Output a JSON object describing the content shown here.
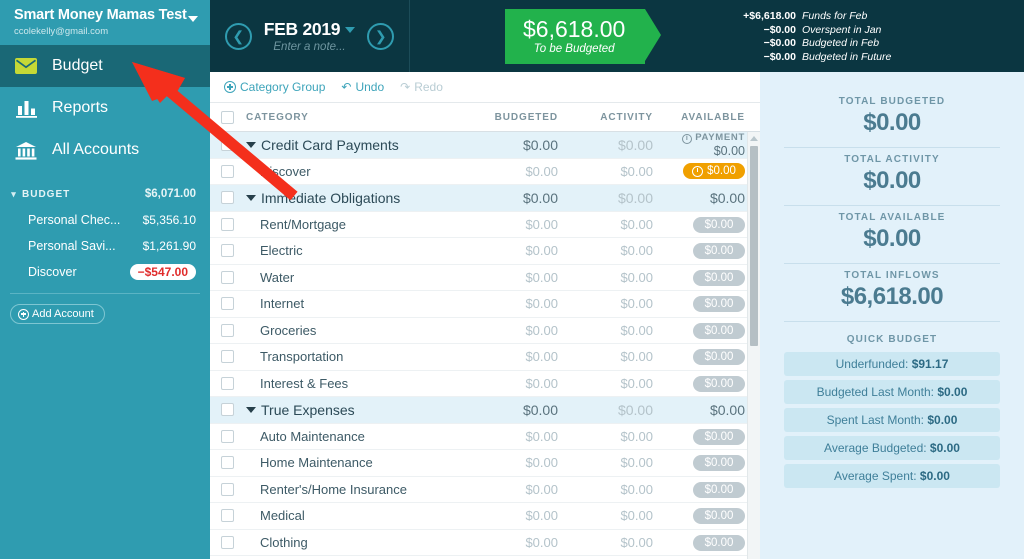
{
  "sidebar": {
    "budget_name": "Smart Money Mamas Test",
    "email": "ccolekelly@gmail.com",
    "nav": [
      {
        "label": "Budget",
        "icon": "envelope-icon",
        "active": true
      },
      {
        "label": "Reports",
        "icon": "bar-chart-icon",
        "active": false
      },
      {
        "label": "All Accounts",
        "icon": "bank-icon",
        "active": false
      }
    ],
    "accounts_header": {
      "label": "BUDGET",
      "amount": "$6,071.00"
    },
    "accounts": [
      {
        "name": "Personal Chec...",
        "balance": "$5,356.10",
        "negative": false
      },
      {
        "name": "Personal Savi...",
        "balance": "$1,261.90",
        "negative": false
      },
      {
        "name": "Discover",
        "balance": "−$547.00",
        "negative": true
      }
    ],
    "add_account_label": "Add Account"
  },
  "header": {
    "prev_icon": "chevron-left-circle-icon",
    "next_icon": "chevron-right-circle-icon",
    "month": "FEB 2019",
    "note_placeholder": "Enter a note...",
    "to_be_budgeted_amount": "$6,618.00",
    "to_be_budgeted_label": "To be Budgeted",
    "breakdown": [
      {
        "amount": "+$6,618.00",
        "label": "Funds for Feb"
      },
      {
        "amount": "−$0.00",
        "label": "Overspent in Jan"
      },
      {
        "amount": "−$0.00",
        "label": "Budgeted in Feb"
      },
      {
        "amount": "−$0.00",
        "label": "Budgeted in Future"
      }
    ]
  },
  "toolbar": {
    "category_group_label": "Category Group",
    "undo_label": "Undo",
    "redo_label": "Redo"
  },
  "table": {
    "columns": {
      "category": "CATEGORY",
      "budgeted": "BUDGETED",
      "activity": "ACTIVITY",
      "available": "AVAILABLE"
    },
    "rows": [
      {
        "type": "group",
        "name": "Credit Card Payments",
        "budgeted": "$0.00",
        "activity": "$0.00",
        "available_kind": "payment",
        "payment_label": "PAYMENT",
        "available": "$0.00"
      },
      {
        "type": "child",
        "name": "Discover",
        "budgeted": "$0.00",
        "activity": "$0.00",
        "available_kind": "pill-orange",
        "available": "$0.00"
      },
      {
        "type": "group",
        "name": "Immediate Obligations",
        "budgeted": "$0.00",
        "activity": "$0.00",
        "available_kind": "plain",
        "available": "$0.00"
      },
      {
        "type": "child",
        "name": "Rent/Mortgage",
        "budgeted": "$0.00",
        "activity": "$0.00",
        "available_kind": "pill",
        "available": "$0.00"
      },
      {
        "type": "child",
        "name": "Electric",
        "budgeted": "$0.00",
        "activity": "$0.00",
        "available_kind": "pill",
        "available": "$0.00"
      },
      {
        "type": "child",
        "name": "Water",
        "budgeted": "$0.00",
        "activity": "$0.00",
        "available_kind": "pill",
        "available": "$0.00"
      },
      {
        "type": "child",
        "name": "Internet",
        "budgeted": "$0.00",
        "activity": "$0.00",
        "available_kind": "pill",
        "available": "$0.00"
      },
      {
        "type": "child",
        "name": "Groceries",
        "budgeted": "$0.00",
        "activity": "$0.00",
        "available_kind": "pill",
        "available": "$0.00"
      },
      {
        "type": "child",
        "name": "Transportation",
        "budgeted": "$0.00",
        "activity": "$0.00",
        "available_kind": "pill",
        "available": "$0.00"
      },
      {
        "type": "child",
        "name": "Interest & Fees",
        "budgeted": "$0.00",
        "activity": "$0.00",
        "available_kind": "pill",
        "available": "$0.00"
      },
      {
        "type": "group",
        "name": "True Expenses",
        "budgeted": "$0.00",
        "activity": "$0.00",
        "available_kind": "plain",
        "available": "$0.00"
      },
      {
        "type": "child",
        "name": "Auto Maintenance",
        "budgeted": "$0.00",
        "activity": "$0.00",
        "available_kind": "pill",
        "available": "$0.00"
      },
      {
        "type": "child",
        "name": "Home Maintenance",
        "budgeted": "$0.00",
        "activity": "$0.00",
        "available_kind": "pill",
        "available": "$0.00"
      },
      {
        "type": "child",
        "name": "Renter's/Home Insurance",
        "budgeted": "$0.00",
        "activity": "$0.00",
        "available_kind": "pill",
        "available": "$0.00"
      },
      {
        "type": "child",
        "name": "Medical",
        "budgeted": "$0.00",
        "activity": "$0.00",
        "available_kind": "pill",
        "available": "$0.00"
      },
      {
        "type": "child",
        "name": "Clothing",
        "budgeted": "$0.00",
        "activity": "$0.00",
        "available_kind": "pill",
        "available": "$0.00"
      }
    ]
  },
  "inspector": {
    "totals": [
      {
        "label": "TOTAL BUDGETED",
        "value": "$0.00"
      },
      {
        "label": "TOTAL ACTIVITY",
        "value": "$0.00"
      },
      {
        "label": "TOTAL AVAILABLE",
        "value": "$0.00"
      },
      {
        "label": "TOTAL INFLOWS",
        "value": "$6,618.00"
      }
    ],
    "quick_budget_title": "QUICK BUDGET",
    "quick_budget": [
      {
        "label": "Underfunded:",
        "value": "$91.17"
      },
      {
        "label": "Budgeted Last Month:",
        "value": "$0.00"
      },
      {
        "label": "Spent Last Month:",
        "value": "$0.00"
      },
      {
        "label": "Average Budgeted:",
        "value": "$0.00"
      },
      {
        "label": "Average Spent:",
        "value": "$0.00"
      }
    ]
  },
  "annotation": {
    "type": "arrow",
    "color": "#f42f1c",
    "points_to": "sidebar-item-budget"
  },
  "colors": {
    "sidebar_bg": "#2f9cb0",
    "sidebar_active": "#1a6876",
    "header_bg": "#0b3641",
    "accent_green": "#22b24c",
    "accent_orange": "#f0a000",
    "inspector_bg": "#e2f1fa",
    "annotation_red": "#f42f1c"
  }
}
